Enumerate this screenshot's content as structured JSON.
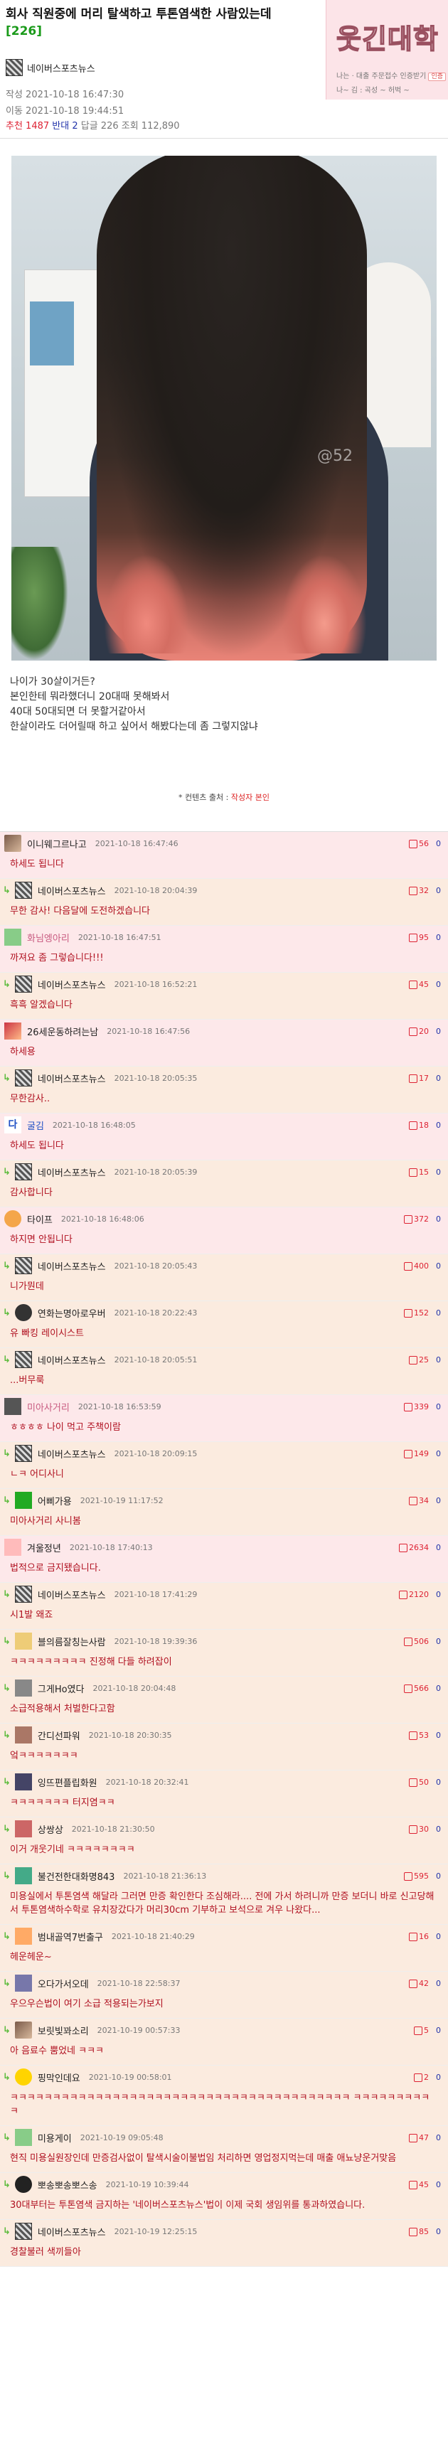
{
  "post": {
    "title": "회사 직원중에 머리 탈색하고 투톤염색한 사람있는데",
    "comment_count": "[226]",
    "author": "네이버스포츠뉴스",
    "created": "작성 2021-10-18 16:47:30",
    "modified": "이동 2021-10-18 19:44:51",
    "stats": {
      "up_label": "추천 1487",
      "down_label": "반대 2",
      "rest": "답글 226 조회 112,890"
    },
    "image_watermark": "@52",
    "body_lines": [
      "나이가 30살이거든?",
      "본인한테 뭐라했더니 20대때 못해봐서",
      "40대 50대되면 더 못할거같아서",
      "한살이라도 더어릴때 하고 싶어서 해봤다는데 좀 그렇지않냐"
    ],
    "source_label": "* 컨텐츠 출처 :",
    "source_value": "작성자 본인"
  },
  "logo": {
    "text": "웃긴대학",
    "sub1": "나는 · 대출 주문접수 인증받기",
    "sub1_tag": "인증",
    "sub2": "나~ 김 : 곡성 ~ 허벅 ~"
  },
  "colors": {
    "best_bg": "#fde8ea",
    "reply_bg": "#fbebdf",
    "reply_arrow": "#5cbb3c",
    "comment_text": "#b01020"
  },
  "comments": [
    {
      "type": "best",
      "name": "이니웨그르나고",
      "date": "2021-10-18 16:47:46",
      "up": "56",
      "down": "0",
      "text": "하세도 됩니다"
    },
    {
      "type": "reply",
      "name": "네이버스포츠뉴스",
      "date": "2021-10-18 20:04:39",
      "up": "32",
      "down": "0",
      "text": "무한 감사! 다음달에 도전하겠습니다"
    },
    {
      "type": "best",
      "name": "화님엥아리",
      "date": "2021-10-18 16:47:51",
      "up": "95",
      "down": "0",
      "text": "까져요 좀 그렇습니다!!!"
    },
    {
      "type": "reply",
      "name": "네이버스포츠뉴스",
      "date": "2021-10-18 16:52:21",
      "up": "45",
      "down": "0",
      "text": "흑흑 알겠습니다"
    },
    {
      "type": "best",
      "name": "26세운동하려는남",
      "date": "2021-10-18 16:47:56",
      "up": "20",
      "down": "0",
      "text": "하세용"
    },
    {
      "type": "reply",
      "name": "네이버스포츠뉴스",
      "date": "2021-10-18 20:05:35",
      "up": "17",
      "down": "0",
      "text": "무한감사.."
    },
    {
      "type": "best",
      "name": "굴김",
      "date": "2021-10-18 16:48:05",
      "up": "18",
      "down": "0",
      "text": "하세도 됩니다"
    },
    {
      "type": "reply",
      "name": "네이버스포츠뉴스",
      "date": "2021-10-18 20:05:39",
      "up": "15",
      "down": "0",
      "text": "감사합니다"
    },
    {
      "type": "best",
      "name": "타이프",
      "date": "2021-10-18 16:48:06",
      "up": "372",
      "down": "0",
      "text": "하지면 안됩니다"
    },
    {
      "type": "reply",
      "name": "네이버스포츠뉴스",
      "date": "2021-10-18 20:05:43",
      "up": "400",
      "down": "0",
      "text": "니가뭔데"
    },
    {
      "type": "reply",
      "name": "연화는명아로우버",
      "date": "2021-10-18 20:22:43",
      "up": "152",
      "down": "0",
      "text": "유 빠킹 레이시스트"
    },
    {
      "type": "reply",
      "name": "네이버스포츠뉴스",
      "date": "2021-10-18 20:05:51",
      "up": "25",
      "down": "0",
      "text": "...버무룩"
    },
    {
      "type": "best",
      "name": "미아사거리",
      "date": "2021-10-18 16:53:59",
      "up": "339",
      "down": "0",
      "text": "ㅎㅎㅎㅎ 나이 먹고 주책이람"
    },
    {
      "type": "reply",
      "name": "네이버스포츠뉴스",
      "date": "2021-10-18 20:09:15",
      "up": "149",
      "down": "0",
      "text": "ㄴㅋ 어디사니"
    },
    {
      "type": "reply",
      "name": "어삐가용",
      "date": "2021-10-19 11:17:52",
      "up": "34",
      "down": "0",
      "text": "미아사거리 사니봄"
    },
    {
      "type": "best",
      "name": "겨울정년",
      "date": "2021-10-18 17:40:13",
      "up": "2634",
      "down": "0",
      "text": "법적으로 금지됐습니다."
    },
    {
      "type": "reply",
      "name": "네이버스포츠뉴스",
      "date": "2021-10-18 17:41:29",
      "up": "2120",
      "down": "0",
      "text": "시1발 왜죠"
    },
    {
      "type": "reply",
      "name": "블의름잘칭는사람",
      "date": "2021-10-18 19:39:36",
      "up": "506",
      "down": "0",
      "text": "ㅋㅋㅋㅋㅋㅋㅋㅋㅋ 진정해 다들 하려잡이"
    },
    {
      "type": "reply",
      "name": "그게Ho였다",
      "date": "2021-10-18 20:04:48",
      "up": "566",
      "down": "0",
      "text": "소급적용해서 처벌한다고함"
    },
    {
      "type": "reply",
      "name": "간디선파워",
      "date": "2021-10-18 20:30:35",
      "up": "53",
      "down": "0",
      "text": "엌ㅋㅋㅋㅋㅋㅋㅋ"
    },
    {
      "type": "reply",
      "name": "잉뜨편플립화원",
      "date": "2021-10-18 20:32:41",
      "up": "50",
      "down": "0",
      "text": "ㅋㅋㅋㅋㅋㅋㅋ 터지염ㅋㅋ"
    },
    {
      "type": "reply",
      "name": "상쌍상",
      "date": "2021-10-18 21:30:50",
      "up": "30",
      "down": "0",
      "text": "이거 개웃기네 ㅋㅋㅋㅋㅋㅋㅋㅋ"
    },
    {
      "type": "reply",
      "name": "불건전한대화명843",
      "date": "2021-10-18 21:36:13",
      "up": "595",
      "down": "0",
      "text": "미용실에서 투톤염색 해달라 그러면 만증 확인한다 조심해라.... 전에 가서 하려니까 만증 보더니 바로 신고당해서 투톤염색하수학로 유치장갔다가 머리30cm 기부하고 보석으로 겨우 나왔다..."
    },
    {
      "type": "reply",
      "name": "범내골역7번출구",
      "date": "2021-10-18 21:40:29",
      "up": "16",
      "down": "0",
      "text": "헤운헤운~"
    },
    {
      "type": "reply",
      "name": "오다가서오데",
      "date": "2021-10-18 22:58:37",
      "up": "42",
      "down": "0",
      "text": "우으우슨법이 여기 소급 적용되는가보지"
    },
    {
      "type": "reply",
      "name": "보릿빛꽈소리",
      "date": "2021-10-19 00:57:33",
      "up": "5",
      "down": "0",
      "text": "아 음료수 뿜었네 ㅋㅋㅋ"
    },
    {
      "type": "reply",
      "name": "핑막인데요",
      "date": "2021-10-19 00:58:01",
      "up": "2",
      "down": "0",
      "text": "ㅋㅋㅋㅋㅋㅋㅋㅋㅋㅋㅋㅋㅋㅋㅋㅋㅋㅋㅋㅋㅋㅋㅋㅋㅋㅋㅋㅋㅋㅋㅋㅋㅋㅋㅋㅋㅋㅋㅋㅋ ㅋㅋㅋㅋㅋㅋㅋㅋㅋㅋ"
    },
    {
      "type": "reply",
      "name": "미용게이",
      "date": "2021-10-19 09:05:48",
      "up": "47",
      "down": "0",
      "text": "현직 미용실원장인데 만증검사없이 탈색시술이불법임 처리하면 영업정지먹는데 매출 애뇨냥운거맞음"
    },
    {
      "type": "reply",
      "name": "뽀송뽀송뽀스송",
      "date": "2021-10-19 10:39:44",
      "up": "45",
      "down": "0",
      "text": "30대부터는 투톤염색 금지하는 '네이버스포츠뉴스'법이 이제 국회 생임위를 통과하였습니다."
    },
    {
      "type": "reply",
      "name": "네이버스포츠뉴스",
      "date": "2021-10-19 12:25:15",
      "up": "85",
      "down": "0",
      "text": "경찰불러 색끼들아"
    }
  ]
}
